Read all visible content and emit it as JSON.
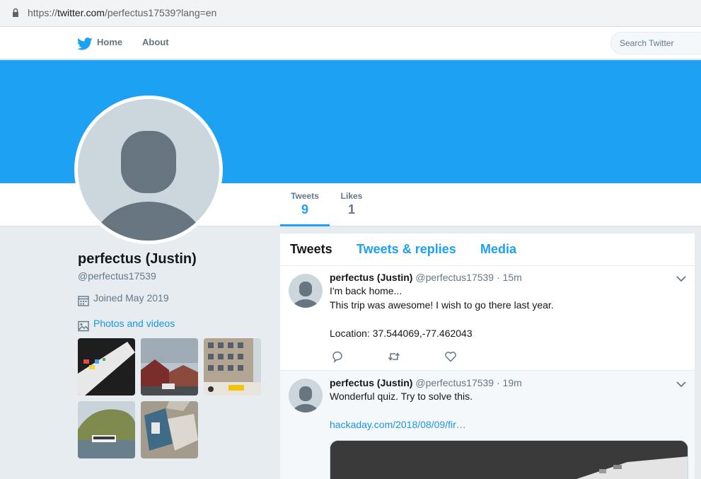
{
  "browser": {
    "url_scheme": "https://",
    "url_host": "twitter.com",
    "url_path": "/perfectus17539?lang=en",
    "lock_icon": "lock-icon"
  },
  "nav": {
    "logo_icon": "twitter-bird-icon",
    "home_label": "Home",
    "about_label": "About",
    "search_placeholder": "Search Twitter"
  },
  "colors": {
    "brand": "#1da1f2",
    "link": "#1b95e0",
    "muted": "#657786"
  },
  "profile": {
    "name": "perfectus (Justin)",
    "handle": "@perfectus17539",
    "joined": "Joined May 2019",
    "photos_label": "Photos and videos",
    "stats": {
      "tweets_label": "Tweets",
      "tweets_value": "9",
      "likes_label": "Likes",
      "likes_value": "1"
    }
  },
  "timeline": {
    "tabs": [
      {
        "label": "Tweets",
        "active": true
      },
      {
        "label": "Tweets & replies",
        "active": false
      },
      {
        "label": "Media",
        "active": false
      }
    ],
    "tweets": [
      {
        "name": "perfectus (Justin)",
        "handle": "@perfectus17539",
        "time": "· 15m",
        "text": "I'm back home...\nThis trip was awesome! I wish to go there last year.\n\nLocation: 37.544069,-77.462043",
        "link": ""
      },
      {
        "name": "perfectus (Justin)",
        "handle": "@perfectus17539",
        "time": "· 19m",
        "text": "Wonderful quiz. Try to solve this.",
        "link": "hackaday.com/2018/08/09/fir…"
      }
    ]
  }
}
